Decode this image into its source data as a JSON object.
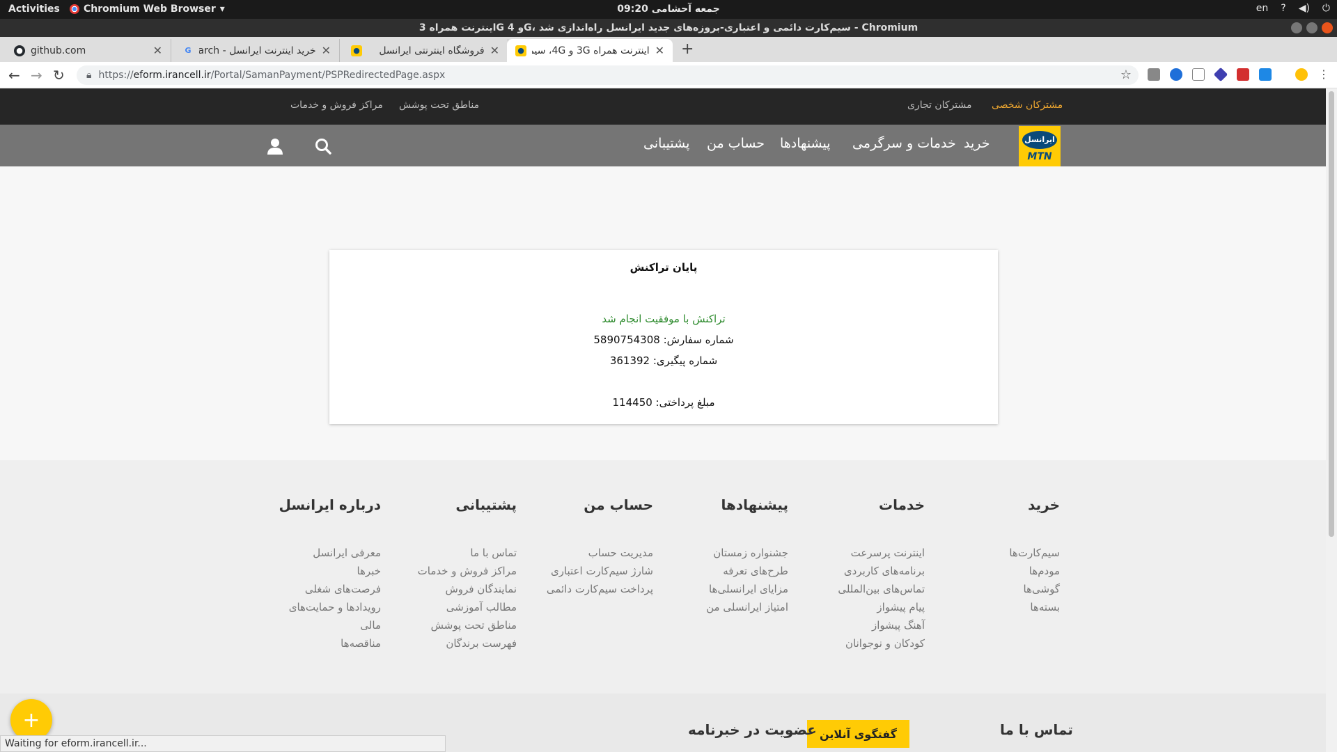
{
  "os_bar": {
    "activities": "Activities",
    "app_menu": "Chromium Web Browser",
    "clock": "جمعه آحشامی 09:20",
    "lang": "en"
  },
  "window": {
    "title": "اینترنت همراه 3G و 4G، سیم‌کارت دائمی و اعتباری-بروزه‌های جدید ایرانسل راه‌اندازی شد - Chromium"
  },
  "tabs": [
    {
      "label": "github.com",
      "icon": "github-icon"
    },
    {
      "label": "خرید اینترنت ایرانسل - earch",
      "icon": "google-icon"
    },
    {
      "label": "فروشگاه اینترنتی ایرانسل",
      "icon": "irancell-icon"
    },
    {
      "label": "اینترنت همراه 3G و 4G، سیم",
      "icon": "irancell-icon"
    }
  ],
  "address": {
    "scheme": "https://",
    "host": "eform.irancell.ir",
    "path": "/Portal/SamanPayment/PSPRedirectedPage.aspx"
  },
  "site_top": {
    "personal": "مشترکان شخصی",
    "business": "مشترکان تجاری",
    "coverage": "مناطق تحت پوشش",
    "centers": "مراکز فروش و خدمات"
  },
  "site_menu": {
    "buy": "خرید",
    "services": "خدمات و سرگرمی",
    "offers": "پیشنهادها",
    "account": "حساب من",
    "support": "پشتیبانی",
    "logo_fa": "ایرانسل",
    "logo_en": "MTN"
  },
  "receipt": {
    "title": "پایان تراکنش",
    "success": "تراکنش با موفقیت انجام شد",
    "order": "شماره سفارش: 5890754308",
    "tracking": "شماره پیگیری: 361392",
    "amount": "مبلغ پرداختی: 114450"
  },
  "footer": {
    "columns": [
      {
        "heading": "خرید",
        "links": [
          "سیم‌کارت‌ها",
          "مودم‌ها",
          "گوشی‌ها",
          "بسته‌ها"
        ]
      },
      {
        "heading": "خدمات",
        "links": [
          "اینترنت پرسرعت",
          "برنامه‌های کاربردی",
          "تماس‌های بین‌المللی",
          "پیام پیشواز",
          "آهنگ پیشواز",
          "کودکان و نوجوانان"
        ]
      },
      {
        "heading": "پیشنهادها",
        "links": [
          "جشنواره زمستان",
          "طرح‌های تعرفه",
          "مزایای ایرانسلی‌ها",
          "امتیاز ایرانسلی من"
        ]
      },
      {
        "heading": "حساب من",
        "links": [
          "مدیریت حساب",
          "شارژ سیم‌کارت اعتباری",
          "پرداخت سیم‌کارت دائمی"
        ]
      },
      {
        "heading": "پشتیبانی",
        "links": [
          "تماس با ما",
          "مراکز فروش و خدمات",
          "نمایندگان فروش",
          "مطالب آموزشی",
          "مناطق تحت پوشش",
          "فهرست برندگان"
        ]
      },
      {
        "heading": "درباره ایرانسل",
        "links": [
          "معرفی ایرانسل",
          "خبرها",
          "فرصت‌های شغلی",
          "رویدادها و حمایت‌های",
          "مالی",
          "مناقصه‌ها"
        ]
      }
    ],
    "contact": "تماس با ما",
    "chat": "گفتگوی آنلاین",
    "newsletter": "عضویت در خبرنامه"
  },
  "status": "Waiting for eform.irancell.ir...",
  "colors": {
    "brand_yellow": "#ffcb05",
    "nav_dark": "#262626",
    "nav_gray": "#757575",
    "success_green": "#2e8b2e",
    "active_top_link": "#f0a830"
  }
}
